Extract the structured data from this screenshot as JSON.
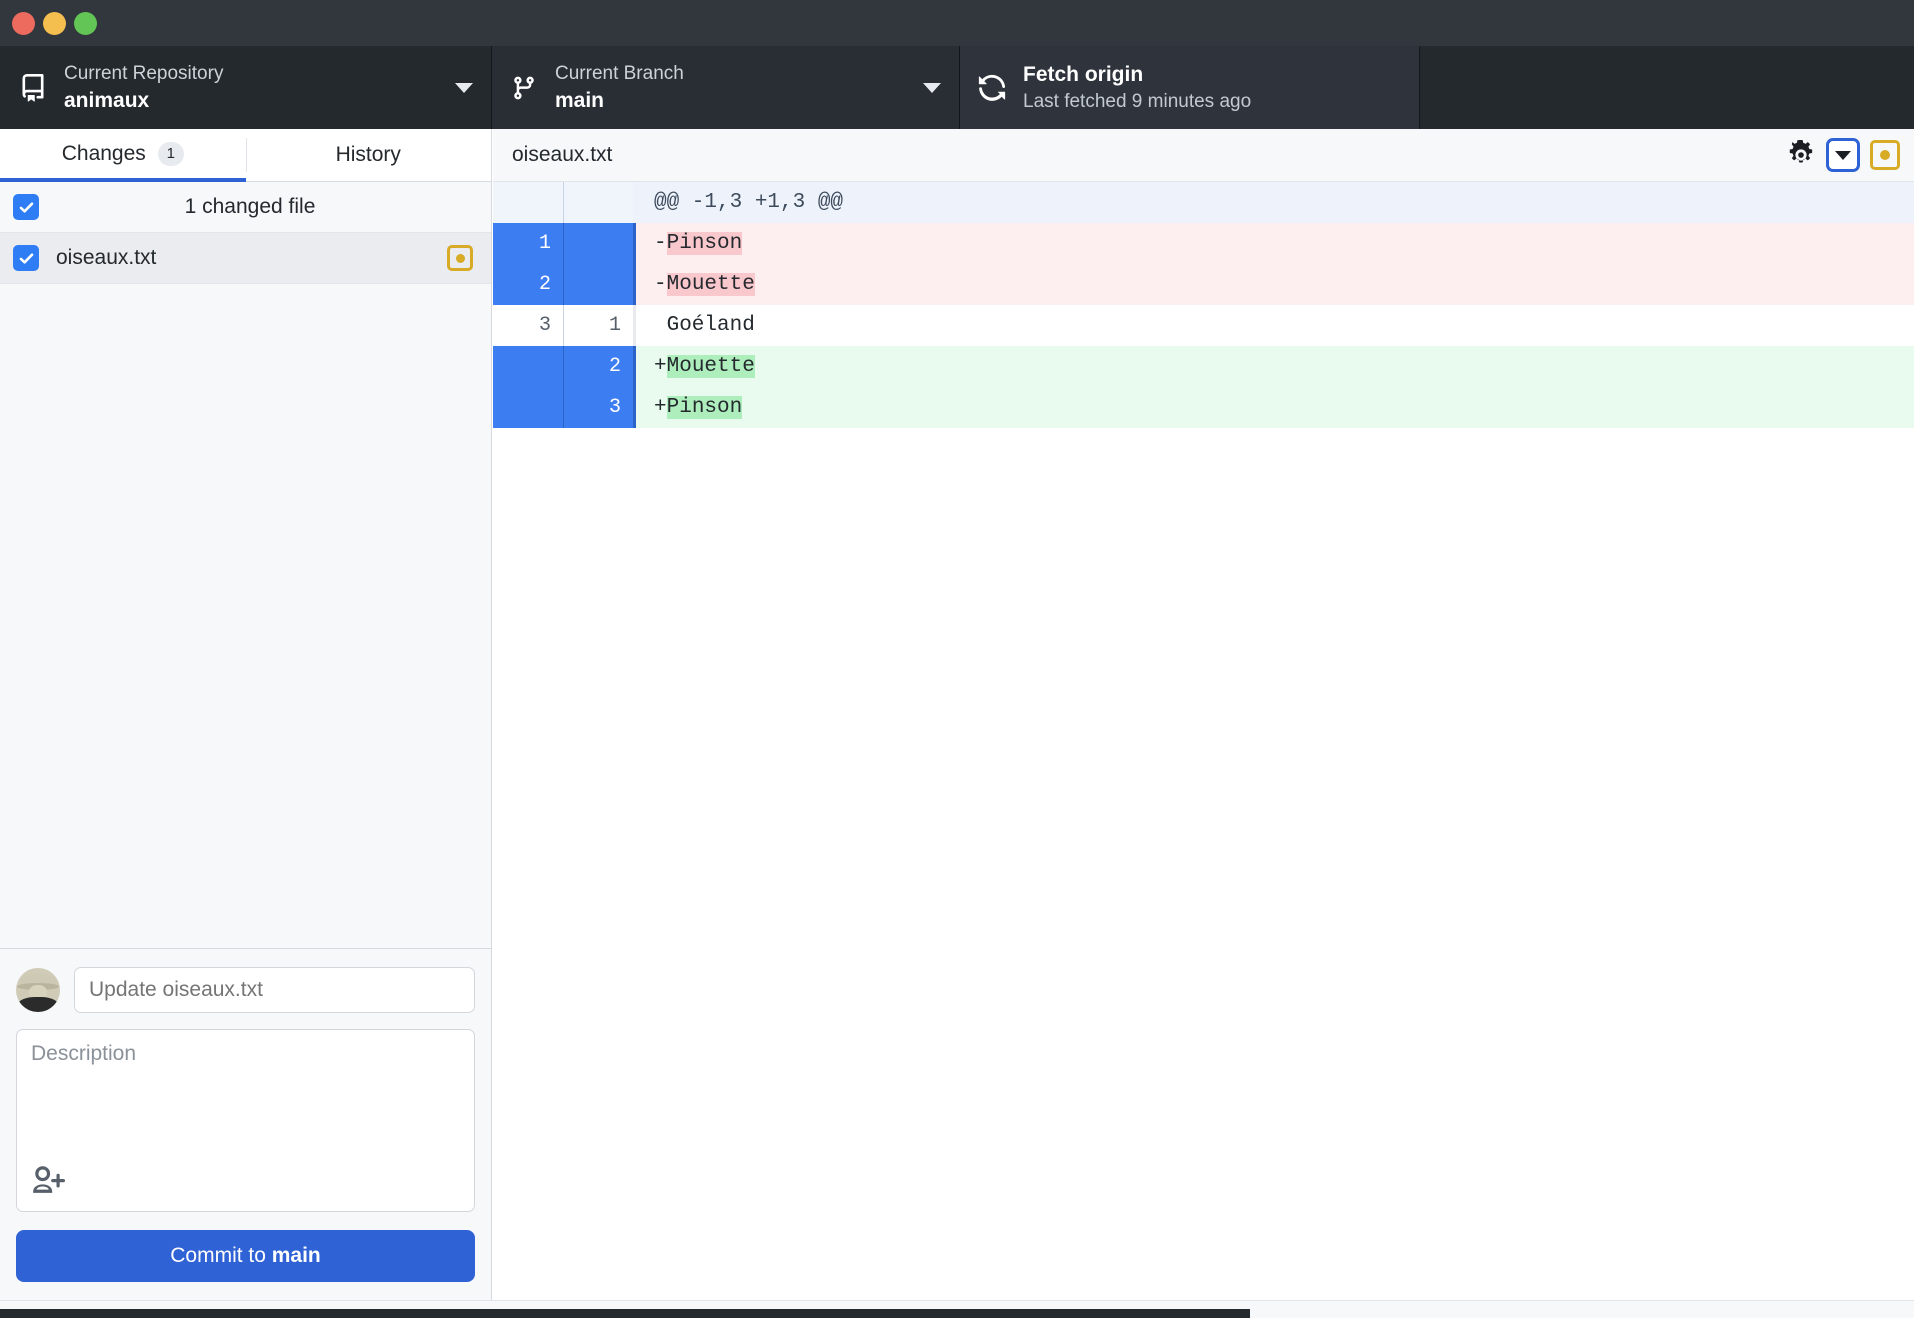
{
  "window": {
    "traffic_lights": [
      "close",
      "minimize",
      "zoom"
    ],
    "colors": {
      "close": "#ed6a5f",
      "minimize": "#f5bf4f",
      "zoom": "#62c555",
      "accent": "#2f62d4",
      "modified": "#d8ab26"
    }
  },
  "toolbar": {
    "repository": {
      "label": "Current Repository",
      "value": "animaux",
      "icon": "repo-icon"
    },
    "branch": {
      "label": "Current Branch",
      "value": "main",
      "icon": "branch-icon"
    },
    "fetch": {
      "title": "Fetch origin",
      "subtitle": "Last fetched 9 minutes ago",
      "icon": "sync-icon"
    }
  },
  "sidebar": {
    "tabs": [
      {
        "label": "Changes",
        "badge": "1",
        "active": true
      },
      {
        "label": "History",
        "badge": "",
        "active": false
      }
    ],
    "list_header": {
      "label": "1 changed file",
      "checked": true
    },
    "files": [
      {
        "name": "oiseaux.txt",
        "checked": true,
        "status": "modified"
      }
    ]
  },
  "commit": {
    "summary_placeholder": "Update oiseaux.txt",
    "summary_value": "",
    "description_placeholder": "Description",
    "description_value": "",
    "coauthor_icon": "add-person-icon",
    "button_prefix": "Commit to ",
    "button_branch": "main"
  },
  "diff": {
    "file_title": "oiseaux.txt",
    "header_icons": [
      "gear-icon",
      "chevron-down-icon",
      "modified-status-icon"
    ],
    "lines": [
      {
        "type": "hunk",
        "old": "",
        "new": "",
        "text": "@@ -1,3 +1,3 @@",
        "token": ""
      },
      {
        "type": "del",
        "old": "1",
        "new": "",
        "text": "-Pinson",
        "token": "Pinson"
      },
      {
        "type": "del",
        "old": "2",
        "new": "",
        "text": "-Mouette",
        "token": "Mouette"
      },
      {
        "type": "ctx",
        "old": "3",
        "new": "1",
        "text": " Goéland",
        "token": ""
      },
      {
        "type": "add",
        "old": "",
        "new": "2",
        "text": "+Mouette",
        "token": "Mouette"
      },
      {
        "type": "add",
        "old": "",
        "new": "3",
        "text": "+Pinson",
        "token": "Pinson"
      }
    ]
  }
}
